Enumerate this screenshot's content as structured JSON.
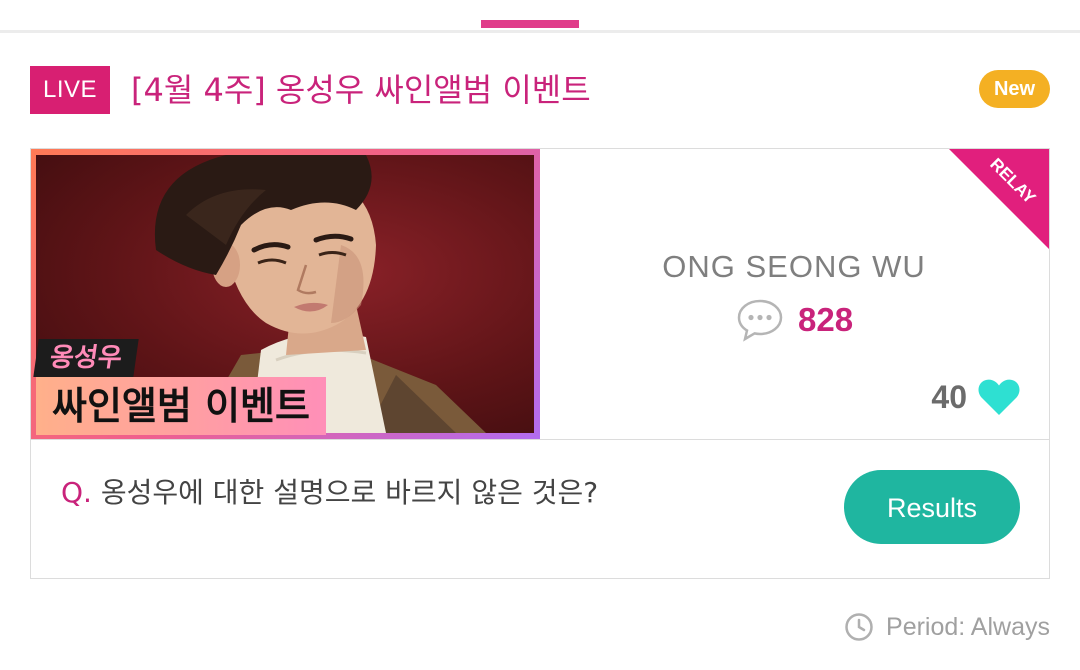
{
  "header": {
    "live_label": "LIVE",
    "title": "[4월 4주] 옹성우 싸인앨범 이벤트",
    "new_label": "New"
  },
  "card": {
    "thumbnail": {
      "tag_small": "옹성우",
      "tag_big": "싸인앨범 이벤트"
    },
    "relay_label": "RELAY",
    "artist_name": "ONG SEONG WU",
    "comment_count": "828",
    "like_count": "40",
    "question_prefix": "Q.",
    "question_text": " 옹성우에 대한 설명으로 바르지 않은 것은?",
    "results_button": "Results"
  },
  "footer": {
    "period": "Period: Always"
  },
  "icons": {
    "comment": "speech-bubble-icon",
    "like": "heart-icon",
    "period": "clock-icon"
  },
  "colors": {
    "brand_pink": "#d81f72",
    "title_pink": "#c9237b",
    "new_badge": "#f4b023",
    "results_teal": "#1fb6a0",
    "heart": "#2ee0d2"
  }
}
